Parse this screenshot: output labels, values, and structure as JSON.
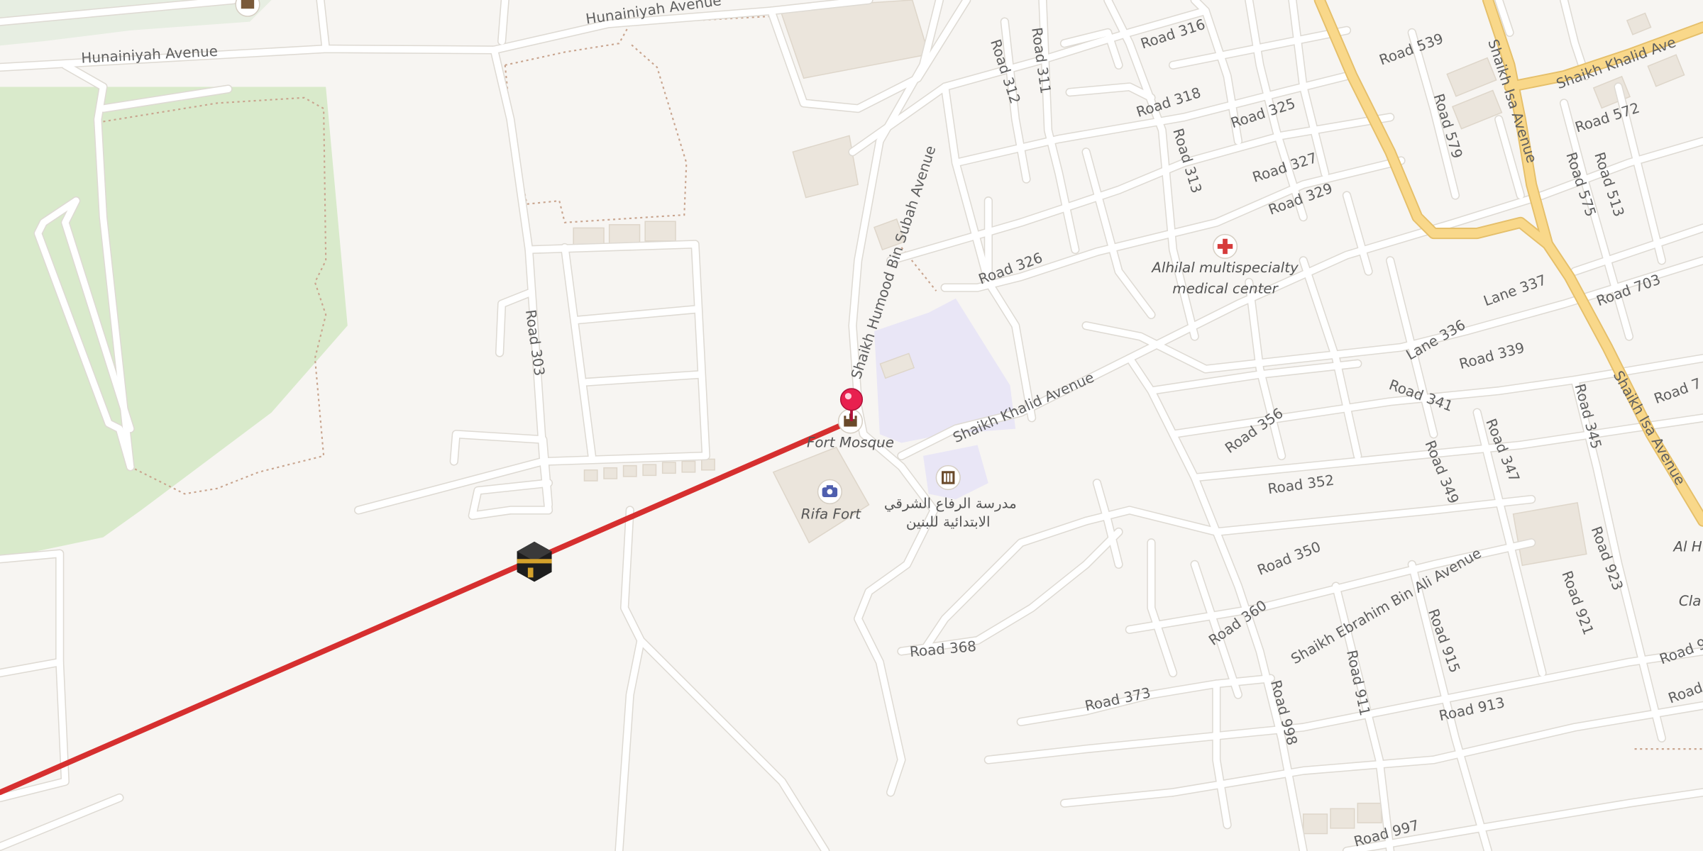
{
  "map": {
    "streets": {
      "hunainiyah_a": "Hunainiyah Avenue",
      "hunainiyah_b": "Hunainiyah Avenue",
      "road_316": "Road 316",
      "road_312": "Road 312",
      "road_311": "Road 311",
      "road_318": "Road 318",
      "road_313": "Road 313",
      "road_325": "Road 325",
      "road_327": "Road 327",
      "road_329": "Road 329",
      "road_539": "Road 539",
      "road_579": "Road 579",
      "shaikh_khalid_ne": "Shaikh Khalid Ave",
      "road_572": "Road 572",
      "road_575": "Road 575",
      "road_513": "Road 513",
      "shaikh_isa_north": "Shaikh Isa Avenue",
      "shaikh_isa_south": "Shaikh Isa Avenue",
      "shaikh_humood": "Shaikh Humood Bin Subah Avenue",
      "road_326": "Road 326",
      "road_303": "Road 303",
      "shaikh_khalid": "Shaikh Khalid Avenue",
      "lane_337": "Lane 337",
      "lane_336": "Lane 336",
      "road_339": "Road 339",
      "road_703": "Road 703",
      "road_341": "Road 341",
      "road_356": "Road 356",
      "road_347": "Road 347",
      "road_345": "Road 345",
      "road_352": "Road 352",
      "road_349": "Road 349",
      "road_350": "Road 350",
      "shaikh_ebrahim": "Shaikh Ebrahim Bin Ali Avenue",
      "road_923": "Road 923",
      "road_360": "Road 360",
      "road_921": "Road 921",
      "road_368": "Road 368",
      "road_915": "Road 915",
      "road_911": "Road 911",
      "road_373": "Road 373",
      "road_998": "Road 998",
      "road_913": "Road 913",
      "road_997": "Road 997",
      "road_7": "Road 7",
      "road_partial_9": "Road 9",
      "road_partial_9b": "Road 9"
    },
    "pois": {
      "fort_mosque": "Fort Mosque",
      "rifa_fort": "Rifa Fort",
      "school_line1": "مدرسة الرفاع الشرقي",
      "school_line2": "الابتدائية للبنين",
      "medical_line1": "Alhilal multispecialty",
      "medical_line2": "medical center",
      "al_h": "Al H",
      "cla": "Cla"
    },
    "icons": {
      "pin": "location-pin-icon",
      "mosque": "mosque-icon",
      "museum": "museum-icon",
      "camera": "camera-icon",
      "school": "school-icon",
      "hospital": "hospital-cross-icon",
      "kaaba": "kaaba-icon"
    },
    "colors": {
      "background": "#f7f5f2",
      "park": "#d9eacb",
      "school_area": "#e9e6f6",
      "major_road": "#f9d88a",
      "qibla_line": "#d62f2f",
      "pin": "#e8204f",
      "hospital": "#d63b3b"
    }
  }
}
